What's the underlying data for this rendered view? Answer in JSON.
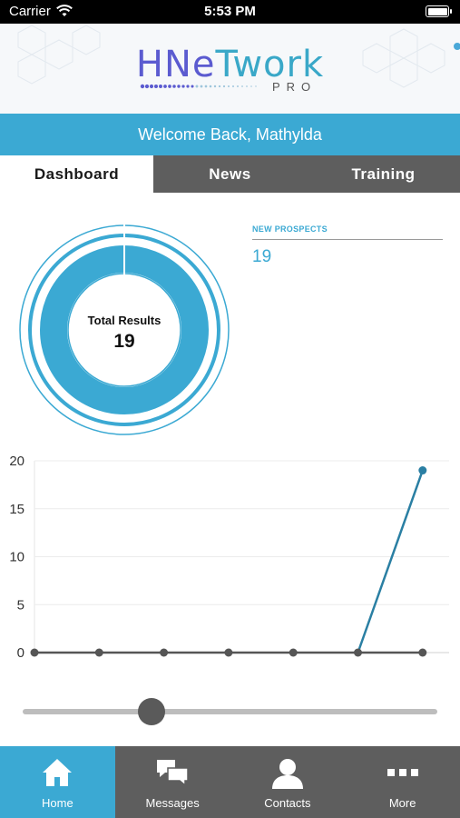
{
  "status_bar": {
    "carrier": "Carrier",
    "time": "5:53 PM"
  },
  "logo": {
    "part1": "HNe",
    "part2": "Twork",
    "sub": "PRO"
  },
  "welcome": "Welcome Back, Mathylda",
  "tabs": [
    {
      "label": "Dashboard",
      "active": true
    },
    {
      "label": "News",
      "active": false
    },
    {
      "label": "Training",
      "active": false
    }
  ],
  "summary": {
    "total_label": "Total Results",
    "total_value": "19"
  },
  "prospects": {
    "label": "NEW PROSPECTS",
    "value": "19"
  },
  "colors": {
    "accent": "#3ba9d3",
    "line": "#2a7fa3",
    "tabs_bg": "#5e5e5e"
  },
  "chart_data": {
    "type": "line",
    "x": [
      1,
      2,
      3,
      4,
      5,
      6,
      7
    ],
    "series": [
      {
        "values": [
          0,
          0,
          0,
          0,
          0,
          0,
          19
        ]
      }
    ],
    "ylim": [
      0,
      20
    ],
    "yticks": [
      "0",
      "5",
      "10",
      "15",
      "20"
    ],
    "grid": true
  },
  "slider": {
    "value": 0.31
  },
  "bottom_nav": [
    {
      "label": "Home",
      "icon": "home-icon",
      "active": true
    },
    {
      "label": "Messages",
      "icon": "messages-icon",
      "active": false
    },
    {
      "label": "Contacts",
      "icon": "contacts-icon",
      "active": false
    },
    {
      "label": "More",
      "icon": "more-icon",
      "active": false
    }
  ]
}
